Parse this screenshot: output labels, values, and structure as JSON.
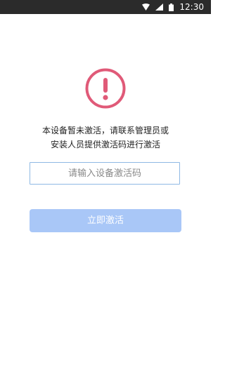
{
  "status_bar": {
    "time": "12:30",
    "icons": [
      "wifi-icon",
      "signal-icon",
      "battery-icon"
    ]
  },
  "alert": {
    "icon": "exclamation-circle-icon",
    "color": "#e05a78"
  },
  "message": {
    "line1": "本设备暂未激活，请联系管理员或",
    "line2": "安装人员提供激活码进行激活"
  },
  "activation_code": {
    "placeholder": "请输入设备激活码",
    "value": ""
  },
  "activate_button": {
    "label": "立即激活",
    "color": "#a9c7f7"
  }
}
